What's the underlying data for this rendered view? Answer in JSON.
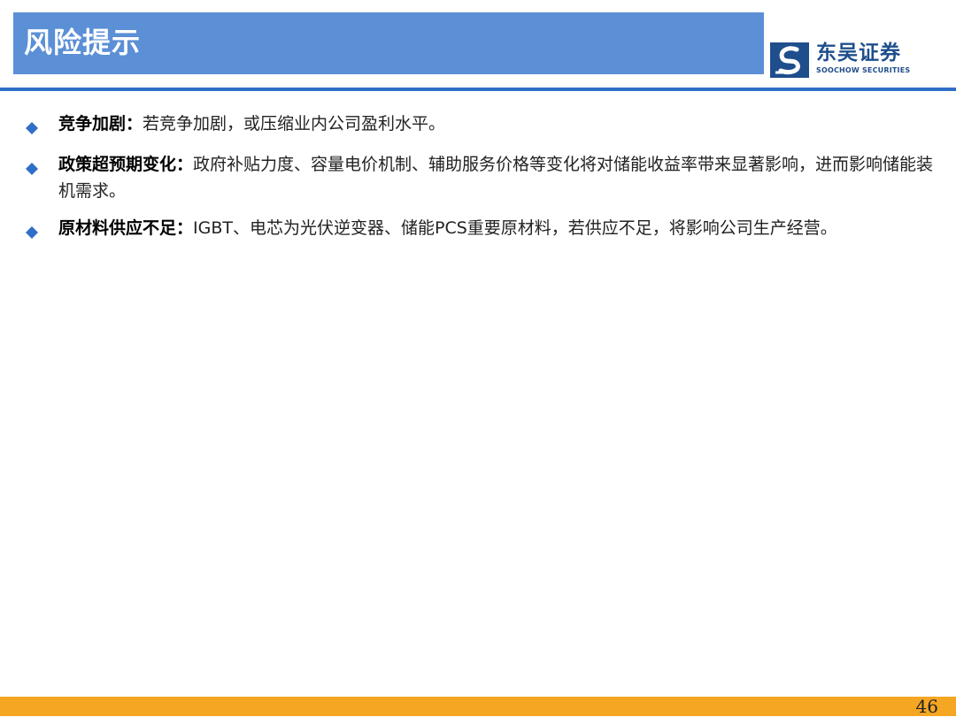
{
  "header": {
    "title": "风险提示"
  },
  "logo": {
    "name_cn": "东吴证券",
    "name_en": "SOOCHOW SECURITIES",
    "icon": "soochow-logo-icon",
    "color": "#1f4e8c"
  },
  "colors": {
    "title_bar": "#5b8fd6",
    "rule": "#2f6fc8",
    "bullet": "#2f6fc8",
    "footer": "#f5a623"
  },
  "bullets": [
    {
      "icon": "diamond-bullet-icon",
      "label": "竞争加剧：",
      "text": "若竞争加剧，或压缩业内公司盈利水平。"
    },
    {
      "icon": "diamond-bullet-icon",
      "label": "政策超预期变化：",
      "text": "政府补贴力度、容量电价机制、辅助服务价格等变化将对储能收益率带来显著影响，进而影响储能装机需求。"
    },
    {
      "icon": "diamond-bullet-icon",
      "label": "原材料供应不足：",
      "text": "IGBT、电芯为光伏逆变器、储能PCS重要原材料，若供应不足，将影响公司生产经营。"
    }
  ],
  "footer": {
    "page_number": "46"
  }
}
